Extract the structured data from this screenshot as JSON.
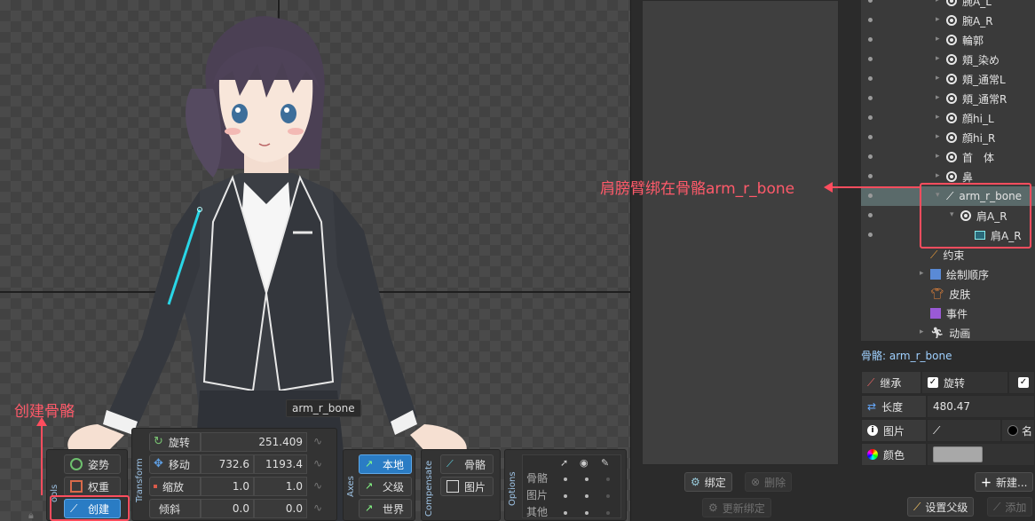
{
  "viewport": {
    "bone_tooltip": "arm_r_bone"
  },
  "annotations": {
    "create_bone": "创建骨骼",
    "arm_binding": "肩膀臂绑在骨骼arm_r_bone"
  },
  "tools": {
    "group_label": "ools",
    "pose": "姿势",
    "weights": "权重",
    "create": "创建"
  },
  "transform": {
    "group_label": "Transform",
    "rotate": {
      "label": "旋转",
      "value": "251.409"
    },
    "translate": {
      "label": "移动",
      "x": "732.6",
      "y": "1193.4"
    },
    "scale": {
      "label": "缩放",
      "x": "1.0",
      "y": "1.0"
    },
    "shear": {
      "label": "倾斜",
      "x": "0.0",
      "y": "0.0"
    }
  },
  "axes": {
    "group_label": "Axes",
    "local": "本地",
    "parent": "父级",
    "world": "世界"
  },
  "compensate": {
    "group_label": "Compensate",
    "bones": "骨骼",
    "images": "图片"
  },
  "options": {
    "group_label": "Options",
    "rows": [
      "骨骼",
      "图片",
      "其他"
    ]
  },
  "middle": {
    "bind": "绑定",
    "delete": "删除",
    "update_binding": "更新绑定"
  },
  "tree": {
    "items": [
      {
        "label": "腕A_L"
      },
      {
        "label": "腕A_R"
      },
      {
        "label": "輪郭"
      },
      {
        "label": "頬_染め"
      },
      {
        "label": "頬_通常L"
      },
      {
        "label": "頬_通常R"
      },
      {
        "label": "顔hi_L"
      },
      {
        "label": "顔hi_R"
      },
      {
        "label": "首　体"
      },
      {
        "label": "鼻"
      },
      {
        "label": "arm_r_bone"
      },
      {
        "label": "肩A_R"
      },
      {
        "label": "肩A_R"
      },
      {
        "label": "约束"
      },
      {
        "label": "绘制顺序"
      },
      {
        "label": "皮肤"
      },
      {
        "label": "事件"
      },
      {
        "label": "动画"
      }
    ]
  },
  "properties": {
    "title": "骨骼: arm_r_bone",
    "inherit": {
      "label": "继承",
      "rotation": "旋转"
    },
    "length": {
      "label": "长度",
      "value": "480.47"
    },
    "image": {
      "label": "图片",
      "name": "名"
    },
    "color": {
      "label": "颜色",
      "swatch": "#a8a8a8"
    },
    "new_button": "新建...",
    "set_parent": "设置父级",
    "add": "添加"
  },
  "colors": {
    "accent": "#2a7cc4",
    "annotation": "#ff4d5e",
    "bone": "#29d6e6"
  }
}
